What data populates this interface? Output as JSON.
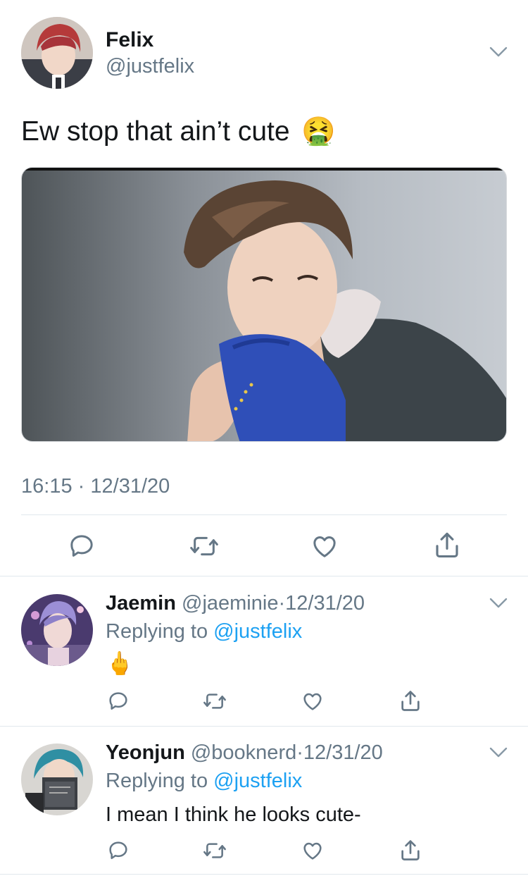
{
  "main_tweet": {
    "display_name": "Felix",
    "handle": "@justfelix",
    "text": "Ew stop that ain’t cute",
    "emoji": "🤮",
    "time": "16:15",
    "separator": "·",
    "date": "12/31/20"
  },
  "replies": [
    {
      "display_name": "Jaemin",
      "handle": "@jaeminie",
      "separator": "·",
      "date": "12/31/20",
      "replying_prefix": "Replying to",
      "replying_handle": "@justfelix",
      "text": "🖕"
    },
    {
      "display_name": "Yeonjun",
      "handle": "@booknerd",
      "separator": "·",
      "date": "12/31/20",
      "replying_prefix": "Replying to",
      "replying_handle": "@justfelix",
      "text": "I mean I think he looks cute-"
    }
  ],
  "colors": {
    "link": "#1da1f2",
    "muted": "#657786",
    "divider": "#e1e8ed"
  },
  "icons": [
    "chevron-down-icon",
    "reply-icon",
    "retweet-icon",
    "like-icon",
    "share-icon"
  ]
}
